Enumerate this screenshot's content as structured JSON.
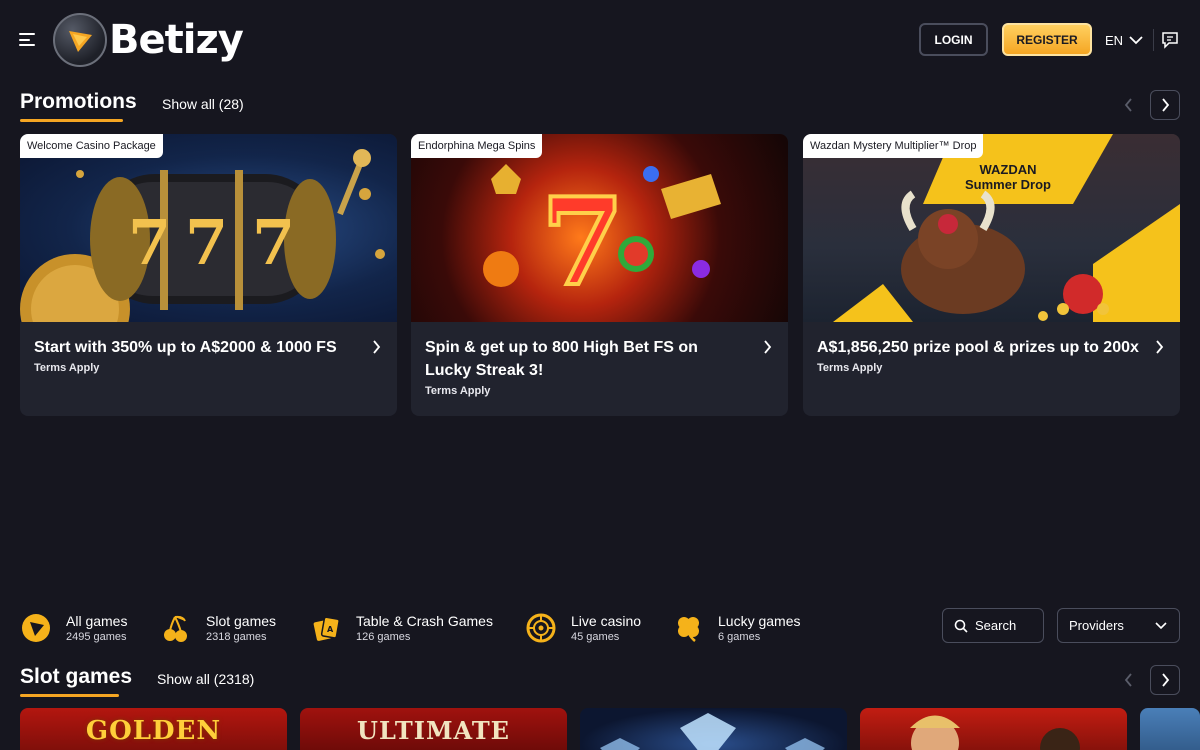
{
  "header": {
    "logo_text": "Betizy",
    "login_label": "LOGIN",
    "register_label": "REGISTER",
    "language": "EN"
  },
  "promotions": {
    "title": "Promotions",
    "show_all": "Show all (28)",
    "cards": [
      {
        "tag": "Welcome Casino Package",
        "title": "Start with 350% up to A$2000 & 1000 FS",
        "terms": "Terms Apply"
      },
      {
        "tag": "Endorphina Mega Spins",
        "title": "Spin & get up to 800 High Bet FS on Lucky Streak 3!",
        "terms": "Terms Apply"
      },
      {
        "tag": "Wazdan Mystery Multiplier™ Drop",
        "title": "A$1,856,250 prize pool & prizes up to 200x",
        "terms": "Terms Apply",
        "art_line1": "WAZDAN",
        "art_line2": "Summer Drop"
      }
    ]
  },
  "categories": [
    {
      "name": "All games",
      "count": "2495 games",
      "icon": "play-icon"
    },
    {
      "name": "Slot games",
      "count": "2318 games",
      "icon": "cherries-icon"
    },
    {
      "name": "Table & Crash Games",
      "count": "126 games",
      "icon": "cards-icon"
    },
    {
      "name": "Live casino",
      "count": "45 games",
      "icon": "roulette-icon"
    },
    {
      "name": "Lucky games",
      "count": "6 games",
      "icon": "clover-icon"
    }
  ],
  "search_label": "Search",
  "providers_label": "Providers",
  "slot_games": {
    "title": "Slot games",
    "show_all": "Show all (2318)",
    "tiles": [
      "GOLDEN",
      "ULTIMATE",
      "",
      "",
      ""
    ]
  },
  "colors": {
    "background": "#16161f",
    "card": "#21232e",
    "accent": "#f5a623"
  }
}
